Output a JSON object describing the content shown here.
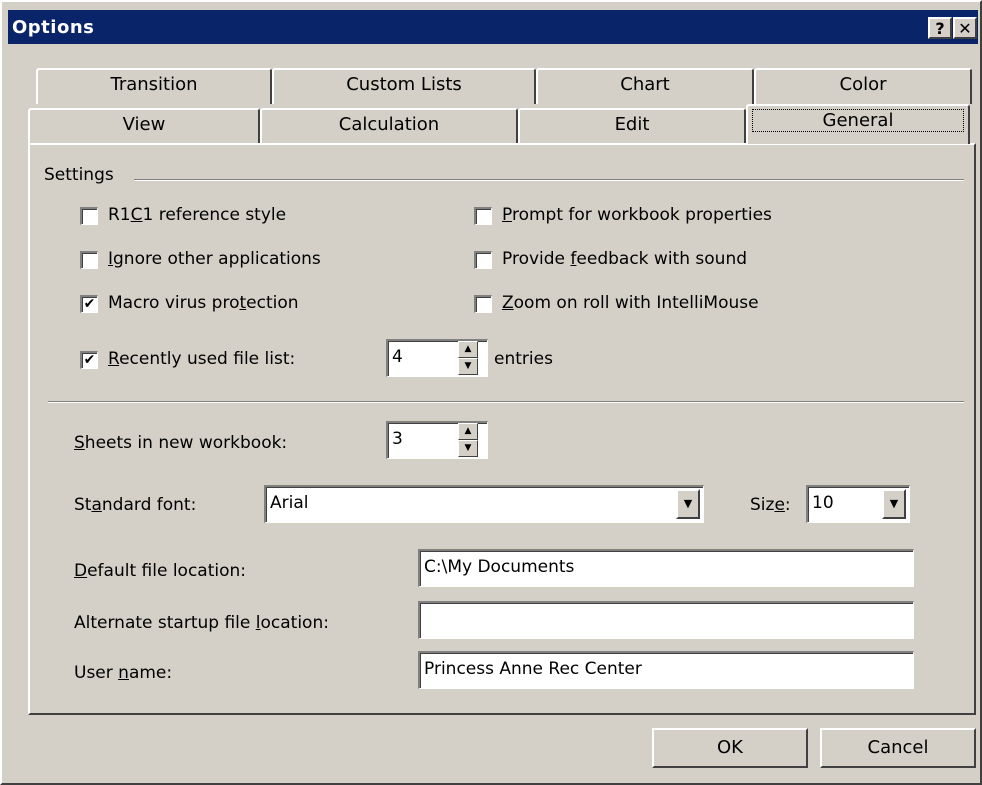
{
  "window": {
    "title": "Options",
    "help_glyph": "?",
    "close_glyph": "✕"
  },
  "tabs_back": [
    "Transition",
    "Custom Lists",
    "Chart",
    "Color"
  ],
  "tabs_front": [
    "View",
    "Calculation",
    "Edit",
    "General"
  ],
  "active_tab": "General",
  "settings": {
    "group_label": "Settings",
    "r1c1": {
      "label": "R1C1 reference style",
      "checked": false
    },
    "ignore_apps": {
      "label": "Ignore other applications",
      "checked": false
    },
    "macro": {
      "label": "Macro virus protection",
      "checked": true
    },
    "prompt_props": {
      "label": "Prompt for workbook properties",
      "checked": false
    },
    "feedback_sound": {
      "label": "Provide feedback with sound",
      "checked": false
    },
    "zoom_roll": {
      "label": "Zoom on roll with IntelliMouse",
      "checked": false
    },
    "recent_files": {
      "label": "Recently used file list:",
      "checked": true,
      "value": "4",
      "suffix": "entries"
    }
  },
  "sheets": {
    "label": "Sheets in new workbook:",
    "value": "3"
  },
  "font": {
    "label": "Standard font:",
    "value": "Arial"
  },
  "size": {
    "label": "Size:",
    "value": "10"
  },
  "default_location": {
    "label": "Default file location:",
    "value": "C:\\My Documents"
  },
  "alt_location": {
    "label": "Alternate startup file location:",
    "value": ""
  },
  "user_name": {
    "label": "User name:",
    "value": "Princess Anne Rec Center"
  },
  "buttons": {
    "ok": "OK",
    "cancel": "Cancel"
  },
  "check_glyph": "✔"
}
